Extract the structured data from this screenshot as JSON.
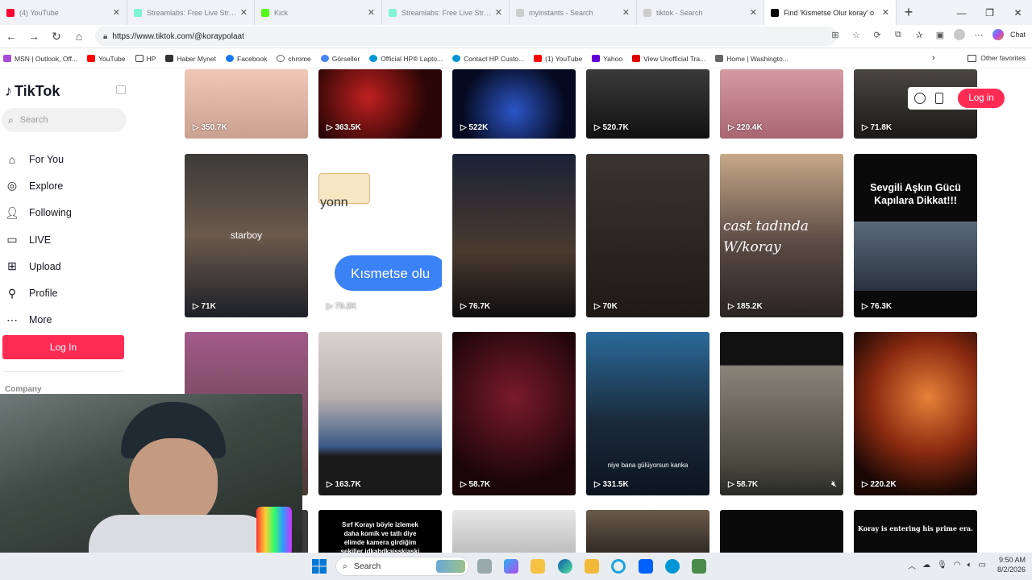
{
  "browser": {
    "tabs": [
      {
        "title": "(4) YouTube",
        "color": "#ff0033"
      },
      {
        "title": "Streamlabs: Free Live Stream",
        "color": "#80f5d2"
      },
      {
        "title": "Kick",
        "color": "#53fc18"
      },
      {
        "title": "Streamlabs: Free Live Stream",
        "color": "#80f5d2"
      },
      {
        "title": "myinstants - Search",
        "color": "#cccccc"
      },
      {
        "title": "tiktok - Search",
        "color": "#cccccc"
      },
      {
        "title": "Find 'Kismetse Olur koray' o",
        "color": "#000000"
      }
    ],
    "new_tab": "+",
    "url": "https://www.tiktok.com/@koraypolaat",
    "chat_label": "Chat",
    "bookmarks": [
      {
        "label": "MSN | Outlook, Off...",
        "color": "#a94ad8"
      },
      {
        "label": "YouTube",
        "color": "#ff0000"
      },
      {
        "label": "HP",
        "color": "#ffffff"
      },
      {
        "label": "Haber Mynet",
        "color": "#333333"
      },
      {
        "label": "Facebook",
        "color": "#1877f2"
      },
      {
        "label": "chrome",
        "color": "#ffffff"
      },
      {
        "label": "Görseller",
        "color": "#4285f4"
      },
      {
        "label": "Official HP® Lapto...",
        "color": "#0096d6"
      },
      {
        "label": "Contact HP Custo...",
        "color": "#0096d6"
      },
      {
        "label": "(1) YouTube",
        "color": "#ff0000"
      },
      {
        "label": "Yahoo",
        "color": "#6001d2"
      },
      {
        "label": "View Unofficial Tra...",
        "color": "#d00"
      },
      {
        "label": "Home | Washingto...",
        "color": "#666666"
      }
    ],
    "other_favorites": "Other favorites"
  },
  "sidebar": {
    "logo": "TikTok",
    "search_placeholder": "Search",
    "items": [
      {
        "label": "For You",
        "icon": "home-icon"
      },
      {
        "label": "Explore",
        "icon": "compass-icon"
      },
      {
        "label": "Following",
        "icon": "following-icon"
      },
      {
        "label": "LIVE",
        "icon": "live-icon"
      },
      {
        "label": "Upload",
        "icon": "upload-icon"
      },
      {
        "label": "Profile",
        "icon": "profile-icon"
      },
      {
        "label": "More",
        "icon": "more-icon"
      }
    ],
    "login": "Log In",
    "company": "Company"
  },
  "header": {
    "login": "Log in"
  },
  "videos": {
    "row1": [
      "350.7K",
      "363.5K",
      "522K",
      "520.7K",
      "220.4K",
      "71.8K"
    ],
    "row2": [
      "71K",
      "79.2K",
      "76.7K",
      "70K",
      "185.2K",
      "76.3K"
    ],
    "row3": [
      "163.7K",
      "58.7K",
      "331.5K",
      "58.7K",
      "220.2K"
    ],
    "captions": {
      "starboy": "starboy",
      "yonn": "yonn",
      "kismetse": "Kısmetse olu",
      "cast_1": "cast tadında",
      "cast_2": "W/koray",
      "sevgili": "Sevgili Aşkın Gücü Kapılara Dikkat!!!",
      "niye": "niye bana gülüyorsun kanka",
      "sirf": "Sırf Korayı böyle izlemek daha komik ve tatlı diye elimde kamera girdiğim sekiller idkahdkaisskiaski",
      "prime": "Koray is entering his prime era."
    }
  },
  "taskbar": {
    "search": "Search",
    "time": "9:50 AM",
    "date": "8/2/2026"
  }
}
